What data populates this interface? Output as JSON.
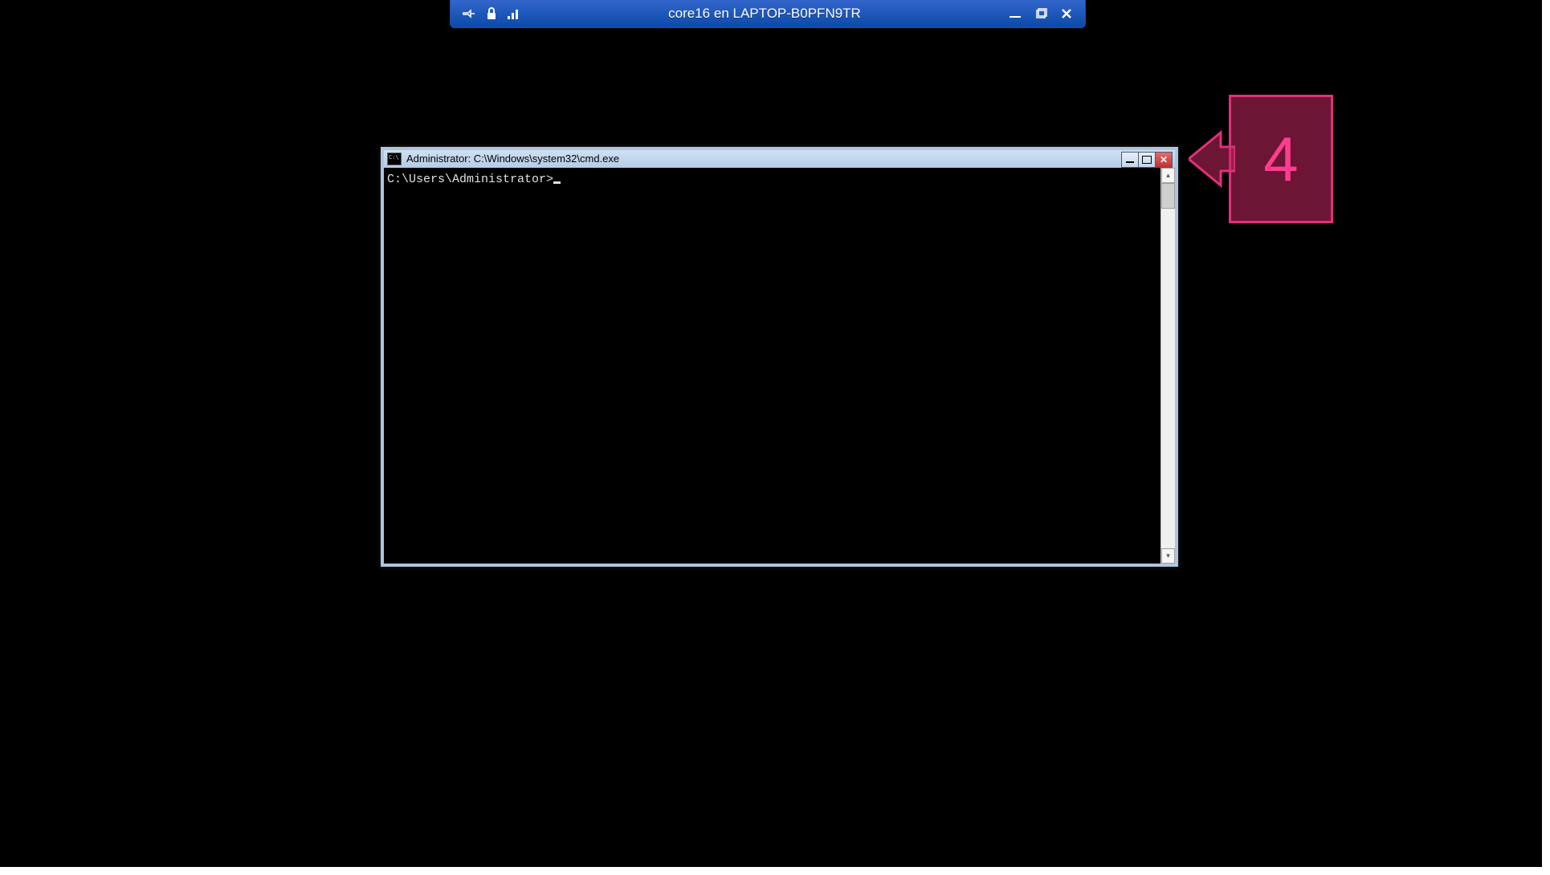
{
  "rdp_bar": {
    "title": "core16 en LAPTOP-B0PFN9TR"
  },
  "cmd_window": {
    "title": "Administrator: C:\\Windows\\system32\\cmd.exe",
    "prompt": "C:\\Users\\Administrator>"
  },
  "callout": {
    "number": "4"
  }
}
